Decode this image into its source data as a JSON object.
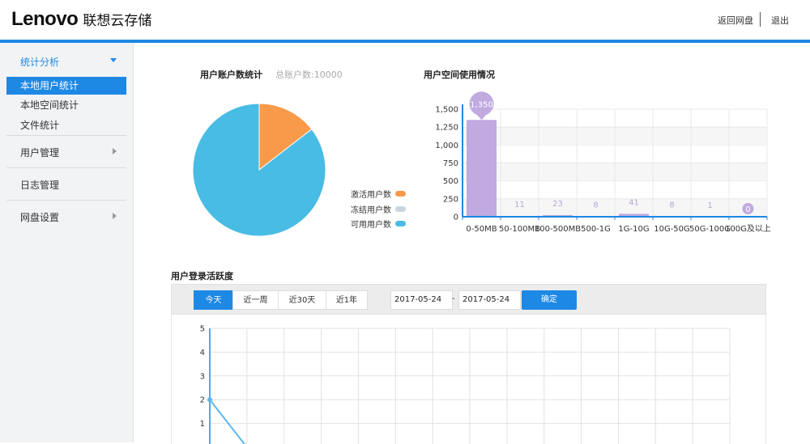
{
  "header": {
    "logo_word": "Lenovo",
    "logo_cn": "联想云存储",
    "back_link": "返回网盘",
    "logout": "退出"
  },
  "sidebar": {
    "groups": [
      {
        "label": "统计分析",
        "expanded": true,
        "items": [
          {
            "label": "本地用户统计",
            "active": true
          },
          {
            "label": "本地空间统计",
            "active": false
          },
          {
            "label": "文件统计",
            "active": false
          }
        ]
      },
      {
        "label": "用户管理",
        "expanded": false
      },
      {
        "label": "日志管理",
        "expanded": false
      },
      {
        "label": "网盘设置",
        "expanded": false
      }
    ]
  },
  "accounts": {
    "title": "用户账户数统计",
    "total": "总账户数:10000"
  },
  "space": {
    "title": "用户空间使用情况"
  },
  "activity": {
    "title": "用户登录活跃度",
    "tabs": [
      "今天",
      "近一周",
      "近30天",
      "近1年"
    ],
    "active_tab": "今天",
    "date_from": "2017-05-24",
    "dash": "-",
    "date_to": "2017-05-24",
    "confirm": "确定"
  },
  "colors": {
    "accent": "#1e88e5",
    "pie_active": "#f9994a",
    "pie_frozen": "#c9d6df",
    "pie_available": "#48bce4",
    "bar": "#c0aae0"
  },
  "chart_data": [
    {
      "type": "pie",
      "labels": [
        "激活用户数",
        "冻结用户数",
        "可用用户数"
      ],
      "values": [
        1450,
        0,
        8550
      ],
      "legend_position": "right-bottom"
    },
    {
      "type": "bar",
      "categories": [
        "0-50MB",
        "50-100MB",
        "100-500MB",
        "500-1G",
        "1G-10G",
        "10G-50G",
        "50G-100G",
        "100G及以上"
      ],
      "values": [
        1350,
        11,
        23,
        8,
        41,
        8,
        1,
        0
      ],
      "ylim": [
        0,
        1500
      ],
      "yticks": [
        0,
        250,
        500,
        750,
        1000,
        1250,
        1500
      ],
      "ytick_labels": [
        "0",
        "250",
        "500",
        "750",
        "1,000",
        "1,250",
        "1,500"
      ],
      "data_labels": [
        "1,350",
        "11",
        "23",
        "8",
        "41",
        "8",
        "1",
        "0"
      ],
      "grid": true
    },
    {
      "type": "line",
      "yticks": [
        1,
        2,
        3,
        4,
        5
      ],
      "ylim": [
        0,
        5
      ],
      "points": [
        [
          0,
          2
        ],
        [
          1,
          0
        ]
      ],
      "grid": true
    }
  ]
}
